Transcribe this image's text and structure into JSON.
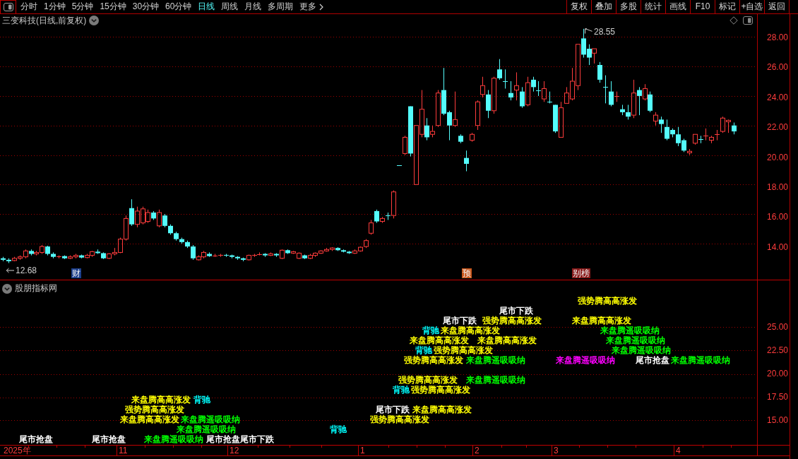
{
  "toolbar": {
    "period_tabs": [
      {
        "label": "分时",
        "selected": false
      },
      {
        "label": "1分钟",
        "selected": false
      },
      {
        "label": "5分钟",
        "selected": false
      },
      {
        "label": "15分钟",
        "selected": false
      },
      {
        "label": "30分钟",
        "selected": false
      },
      {
        "label": "60分钟",
        "selected": false
      },
      {
        "label": "日线",
        "selected": true
      },
      {
        "label": "周线",
        "selected": false
      },
      {
        "label": "月线",
        "selected": false
      },
      {
        "label": "多周期",
        "selected": false
      }
    ],
    "more_menu": {
      "label": "更多"
    },
    "buttons": [
      "复权",
      "叠加",
      "多股",
      "统计",
      "画线",
      "F10",
      "标记",
      "+自选",
      "返回"
    ]
  },
  "price_chart": {
    "title": "三变科技(日线,前复权)",
    "y_axis_labels": [
      "28.00",
      "26.00",
      "24.00",
      "22.00",
      "20.00",
      "18.00",
      "16.00",
      "14.00"
    ],
    "high_label": "28.55",
    "low_label": "12.68",
    "events": [
      {
        "text": "财",
        "color": "#1c3f8c"
      },
      {
        "text": "预",
        "color": "#c8561a"
      },
      {
        "text": "别榜",
        "color": "#8a1c1c"
      }
    ]
  },
  "indicator_panel": {
    "title": "股朋指标网",
    "y_axis_labels": [
      "25.00",
      "22.50",
      "20.00",
      "17.50",
      "15.00"
    ],
    "signals": [
      {
        "text": "强势腾高高涨发",
        "color": "#ffff00"
      },
      {
        "text": "尾市下跌",
        "color": "#ffffff"
      },
      {
        "text": "尾市下跌",
        "color": "#ffffff"
      },
      {
        "text": "强势腾高高涨发",
        "color": "#ffff00"
      },
      {
        "text": "来盘腾高高涨发",
        "color": "#ffff00"
      },
      {
        "text": "背驰",
        "color": "#00ffff"
      },
      {
        "text": "来盘腾高高涨发",
        "color": "#ffff00"
      },
      {
        "text": "来盘腾遥吸吸纳",
        "color": "#00ff00"
      },
      {
        "text": "来盘腾高高涨发",
        "color": "#ffff00"
      },
      {
        "text": "来盘腾高高涨发",
        "color": "#ffff00"
      },
      {
        "text": "来盘腾遥吸吸纳",
        "color": "#00ff00"
      },
      {
        "text": "背驰",
        "color": "#00ffff"
      },
      {
        "text": "强势腾高高涨发",
        "color": "#ffff00"
      },
      {
        "text": "来盘腾遥吸吸纳",
        "color": "#00ff00"
      },
      {
        "text": "强势腾高高涨发",
        "color": "#ffff00"
      },
      {
        "text": "来盘腾遥吸吸纳",
        "color": "#00ff00"
      },
      {
        "text": "来盘腾遥吸吸纳",
        "color": "#ff00ff"
      },
      {
        "text": "尾市抢盘",
        "color": "#ffffff"
      },
      {
        "text": "来盘腾遥吸吸纳",
        "color": "#00ff00"
      },
      {
        "text": "强势腾高高涨发",
        "color": "#ffff00"
      },
      {
        "text": "来盘腾遥吸吸纳",
        "color": "#00ff00"
      },
      {
        "text": "背驰",
        "color": "#00ffff"
      },
      {
        "text": "强势腾高高涨发",
        "color": "#ffff00"
      },
      {
        "text": "来盘腾高高涨发",
        "color": "#ffff00"
      },
      {
        "text": "背驰",
        "color": "#00ffff"
      },
      {
        "text": "强势腾高高涨发",
        "color": "#ffff00"
      },
      {
        "text": "尾市下跌",
        "color": "#ffffff"
      },
      {
        "text": "来盘腾高高涨发",
        "color": "#ffff00"
      },
      {
        "text": "来盘腾高高涨发",
        "color": "#ffff00"
      },
      {
        "text": "来盘腾遥吸吸纳",
        "color": "#00ff00"
      },
      {
        "text": "强势腾高高涨发",
        "color": "#ffff00"
      },
      {
        "text": "来盘腾遥吸吸纳",
        "color": "#00ff00"
      },
      {
        "text": "背驰",
        "color": "#00ffff"
      },
      {
        "text": "尾市抢盘",
        "color": "#ffffff"
      },
      {
        "text": "尾市抢盘",
        "color": "#ffffff"
      },
      {
        "text": "来盘腾遥吸吸纳",
        "color": "#00ff00"
      },
      {
        "text": "尾市抢盘",
        "color": "#ffffff"
      },
      {
        "text": "尾市下跌",
        "color": "#ffffff"
      }
    ]
  },
  "x_axis": {
    "labels": [
      "2025年",
      "11",
      "12",
      "1",
      "2",
      "3",
      "4"
    ]
  }
}
